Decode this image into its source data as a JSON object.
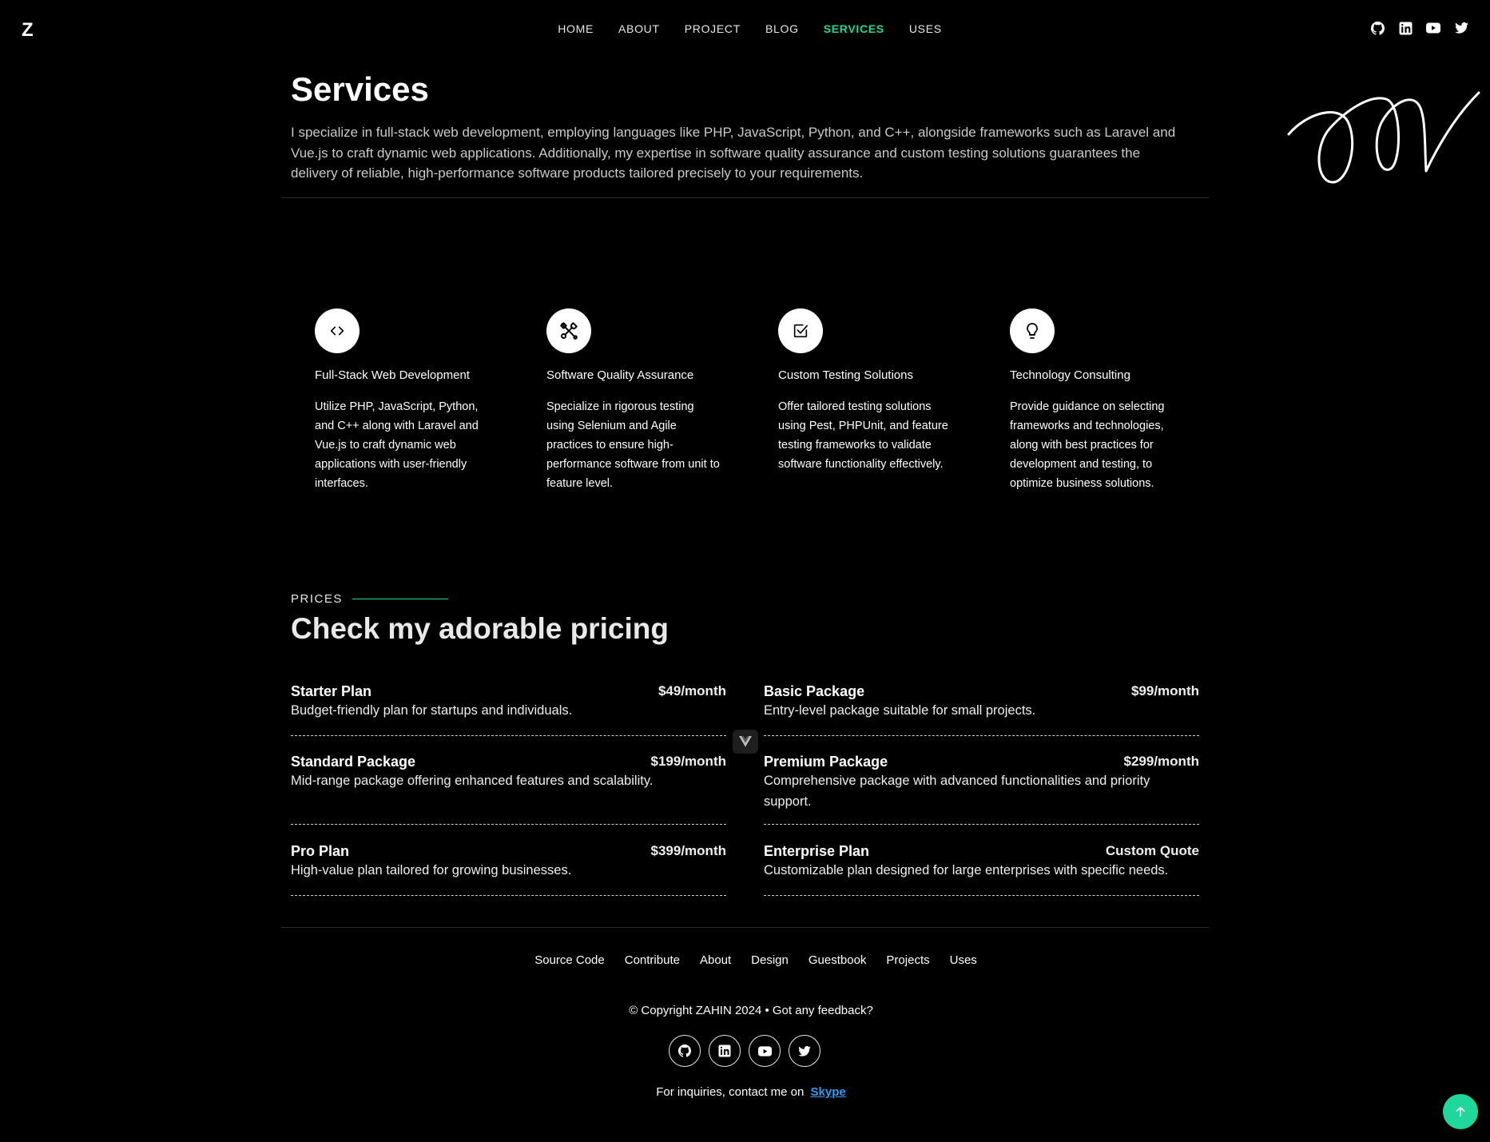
{
  "header": {
    "logo": "Z",
    "nav": [
      {
        "label": "HOME"
      },
      {
        "label": "ABOUT"
      },
      {
        "label": "PROJECT"
      },
      {
        "label": "BLOG"
      },
      {
        "label": "SERVICES",
        "active": true
      },
      {
        "label": "USES"
      }
    ],
    "social": [
      "github-icon",
      "linkedin-icon",
      "youtube-icon",
      "twitter-icon"
    ]
  },
  "page": {
    "title": "Services",
    "intro": "I specialize in full-stack web development, employing languages like PHP, JavaScript, Python, and C++, alongside frameworks such as Laravel and Vue.js to craft dynamic web applications. Additionally, my expertise in software quality assurance and custom testing solutions guarantees the delivery of reliable, high-performance software products tailored precisely to your requirements."
  },
  "services": [
    {
      "icon": "code-icon",
      "title": "Full-Stack Web Development",
      "desc": "Utilize PHP, JavaScript, Python, and C++ along with Laravel and Vue.js to craft dynamic web applications with user-friendly interfaces."
    },
    {
      "icon": "tools-icon",
      "title": "Software Quality Assurance",
      "desc": "Specialize in rigorous testing using Selenium and Agile practices to ensure high-performance software from unit to feature level."
    },
    {
      "icon": "checkbox-icon",
      "title": "Custom Testing Solutions",
      "desc": "Offer tailored testing solutions using Pest, PHPUnit, and feature testing frameworks to validate software functionality effectively."
    },
    {
      "icon": "lightbulb-icon",
      "title": "Technology Consulting",
      "desc": "Provide guidance on selecting frameworks and technologies, along with best practices for development and testing, to optimize business solutions."
    }
  ],
  "prices": {
    "label": "PRICES",
    "heading": "Check my adorable pricing",
    "plans": [
      {
        "name": "Starter Plan",
        "price": "$49/month",
        "desc": "Budget-friendly plan for startups and individuals."
      },
      {
        "name": "Basic Package",
        "price": "$99/month",
        "desc": "Entry-level package suitable for small projects."
      },
      {
        "name": "Standard Package",
        "price": "$199/month",
        "desc": "Mid-range package offering enhanced features and scalability."
      },
      {
        "name": "Premium Package",
        "price": "$299/month",
        "desc": "Comprehensive package with advanced functionalities and priority support."
      },
      {
        "name": "Pro Plan",
        "price": "$399/month",
        "desc": "High-value plan tailored for growing businesses."
      },
      {
        "name": "Enterprise Plan",
        "price": "Custom Quote",
        "desc": "Customizable plan designed for large enterprises with specific needs."
      }
    ]
  },
  "footer": {
    "links": [
      {
        "label": "Source Code"
      },
      {
        "label": "Contribute"
      },
      {
        "label": "About"
      },
      {
        "label": "Design"
      },
      {
        "label": "Guestbook"
      },
      {
        "label": "Projects"
      },
      {
        "label": "Uses"
      }
    ],
    "copyright": "© Copyright ZAHIN 2024 • Got any feedback?",
    "inquiry_text": "For inquiries, contact me on",
    "skype_label": "Skype",
    "social": [
      "github-icon",
      "linkedin-icon",
      "youtube-icon",
      "twitter-icon"
    ]
  },
  "colors": {
    "accent": "#1fd79b",
    "link": "#2d9cf5",
    "background": "#000000"
  }
}
